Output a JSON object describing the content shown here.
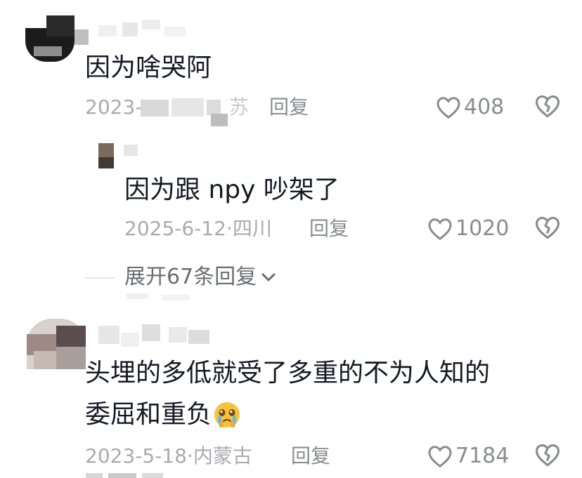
{
  "comments": [
    {
      "text": "因为啥哭阿",
      "date": "2023-5",
      "location": "苏",
      "reply_label": "回复",
      "likes": "408",
      "replies": [
        {
          "text": "因为跟 npy 吵架了",
          "date": "2025-6-12",
          "location": "四川",
          "reply_label": "回复",
          "likes": "1020"
        }
      ],
      "expand_label": "展开67条回复"
    },
    {
      "text_line1": "头埋的多低就受了多重的不为人知的",
      "text_line2": "委屈和重负",
      "emoji": "crying-face-emoji",
      "date": "2023-5-18",
      "location": "内蒙古",
      "reply_label": "回复",
      "likes": "7184"
    }
  ],
  "separator": "·",
  "icons": {
    "like": "heart-outline-icon",
    "dislike": "broken-heart-icon",
    "expand": "chevron-down-icon"
  },
  "colors": {
    "text": "#161823",
    "meta": "#a9aaaf",
    "action": "#8a8b91"
  }
}
